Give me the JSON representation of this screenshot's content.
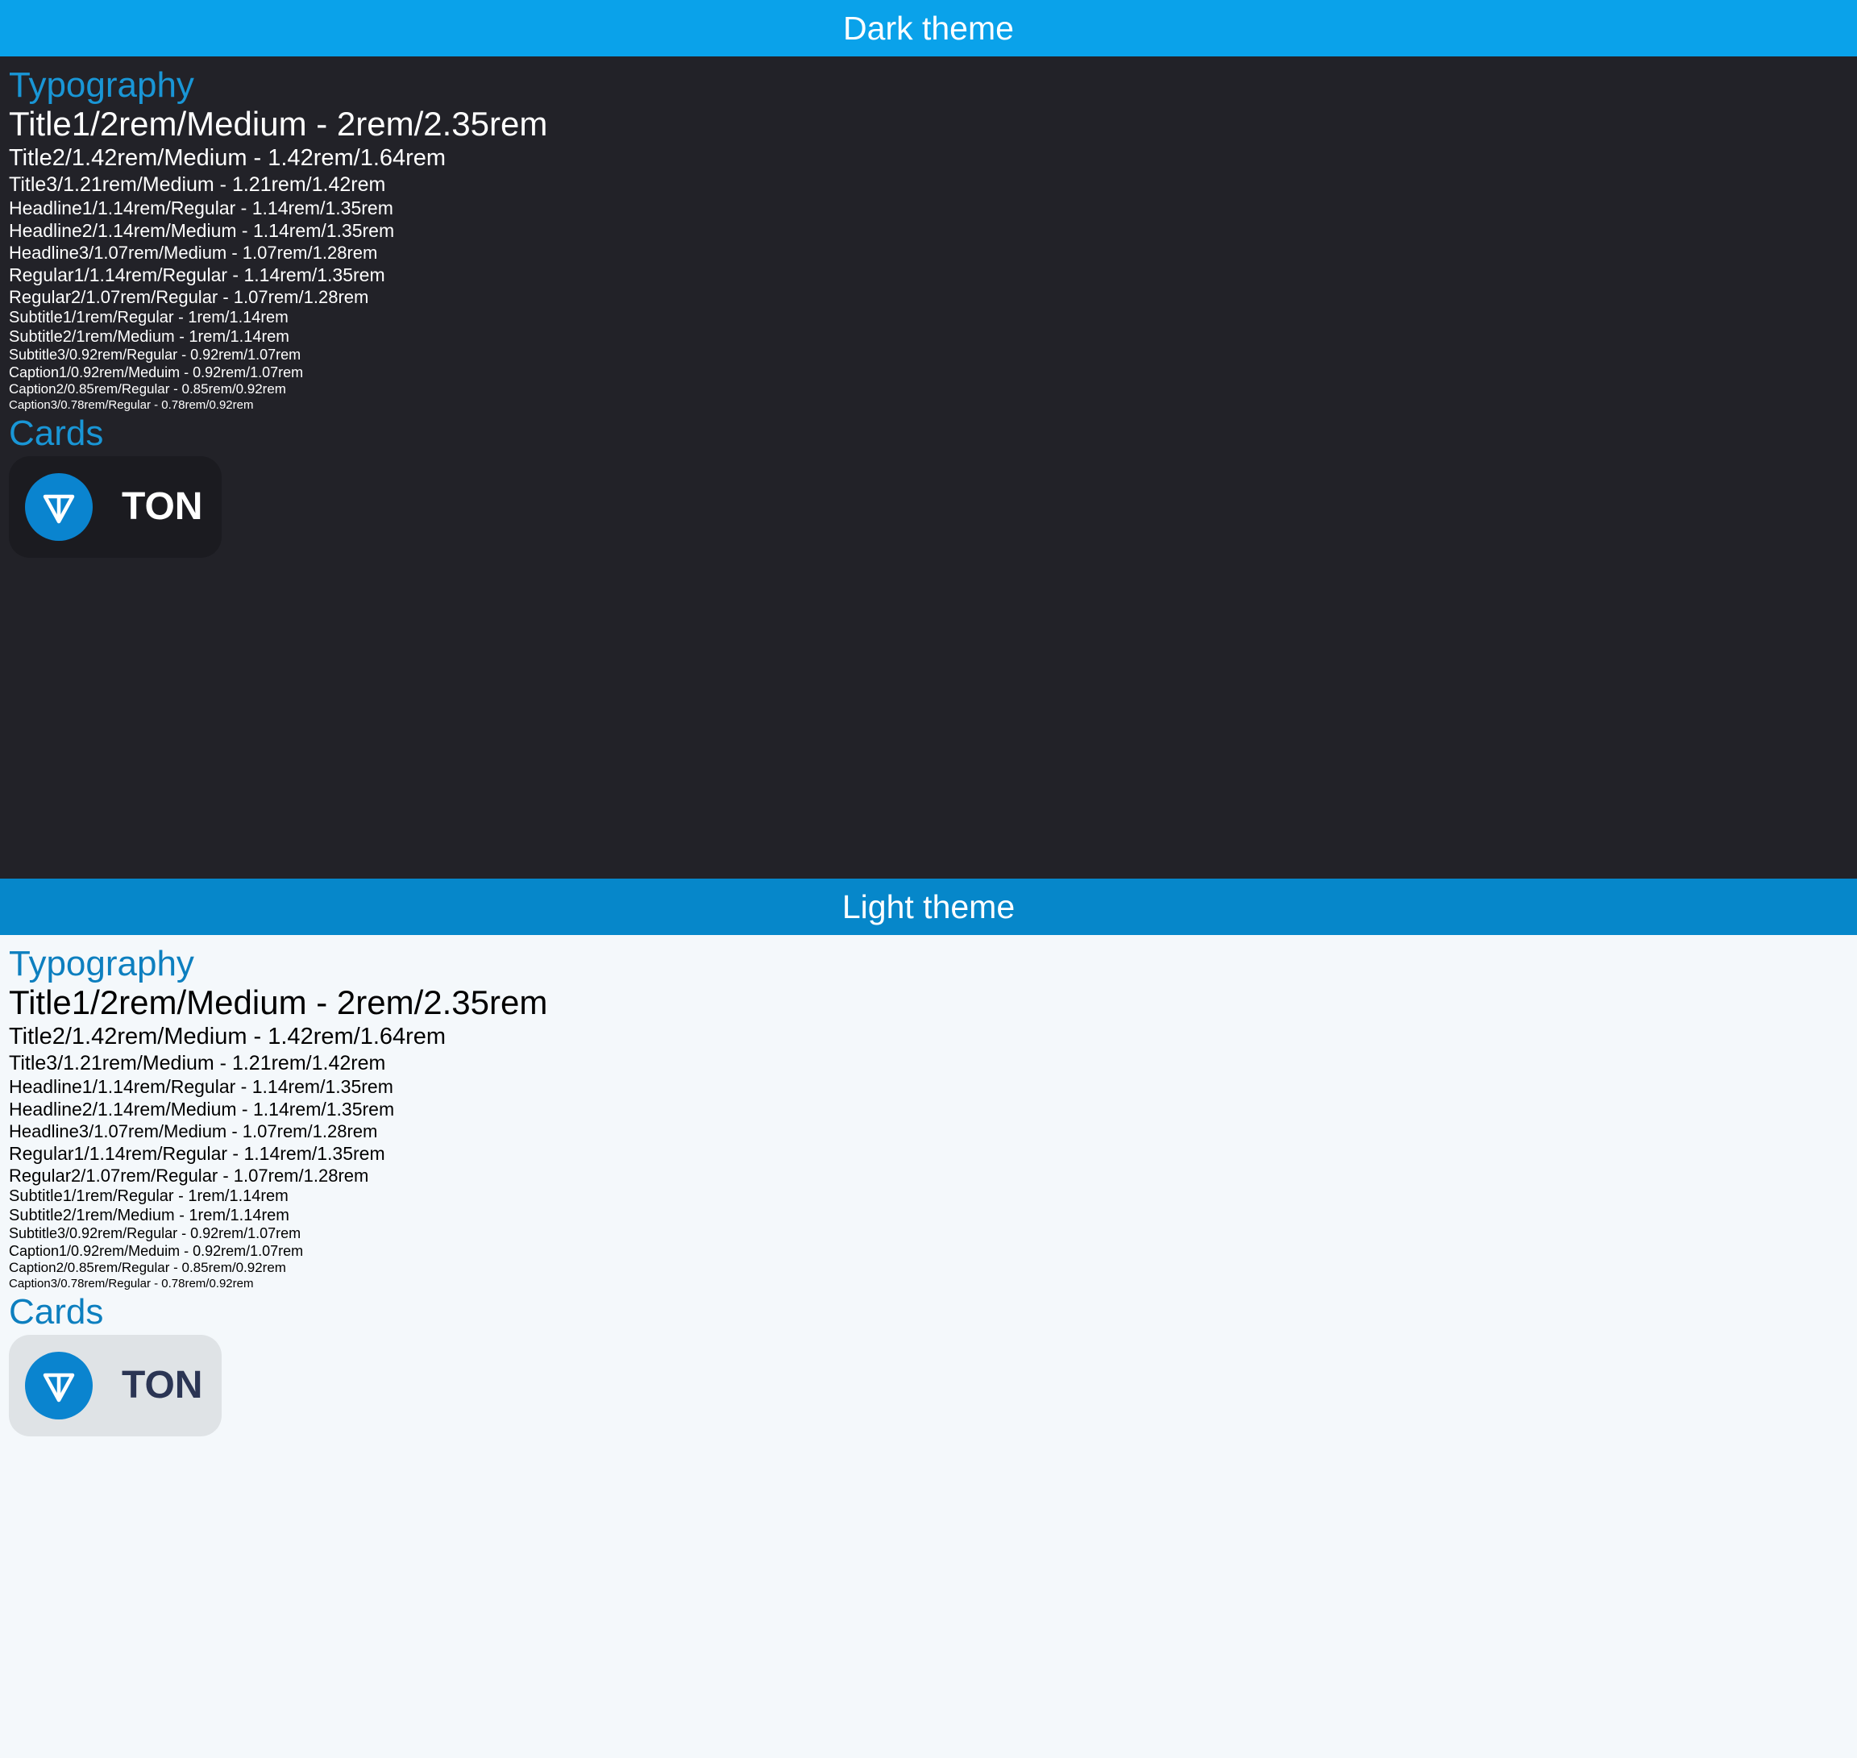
{
  "dark": {
    "header": "Dark theme",
    "typography_heading": "Typography",
    "cards_heading": "Cards",
    "card_label": "TON"
  },
  "light": {
    "header": "Light theme",
    "typography_heading": "Typography",
    "cards_heading": "Cards",
    "card_label": "TON"
  },
  "typography": [
    "Title1/2rem/Medium - 2rem/2.35rem",
    "Title2/1.42rem/Medium - 1.42rem/1.64rem",
    "Title3/1.21rem/Medium - 1.21rem/1.42rem",
    "Headline1/1.14rem/Regular - 1.14rem/1.35rem",
    "Headline2/1.14rem/Medium - 1.14rem/1.35rem",
    "Headline3/1.07rem/Medium - 1.07rem/1.28rem",
    "Regular1/1.14rem/Regular - 1.14rem/1.35rem",
    "Regular2/1.07rem/Regular - 1.07rem/1.28rem",
    "Subtitle1/1rem/Regular - 1rem/1.14rem",
    "Subtitle2/1rem/Medium - 1rem/1.14rem",
    "Subtitle3/0.92rem/Regular - 0.92rem/1.07rem",
    "Caption1/0.92rem/Meduim - 0.92rem/1.07rem",
    "Caption2/0.85rem/Regular - 0.85rem/0.92rem",
    "Caption3/0.78rem/Regular - 0.78rem/0.92rem"
  ],
  "colors": {
    "dark_bg": "#222228",
    "dark_header": "#0aa2ea",
    "light_bg": "#f4f8fb",
    "light_header": "#0687ca",
    "ton_blue": "#0a84cf"
  },
  "icons": {
    "coin": "ton-logo-icon"
  }
}
